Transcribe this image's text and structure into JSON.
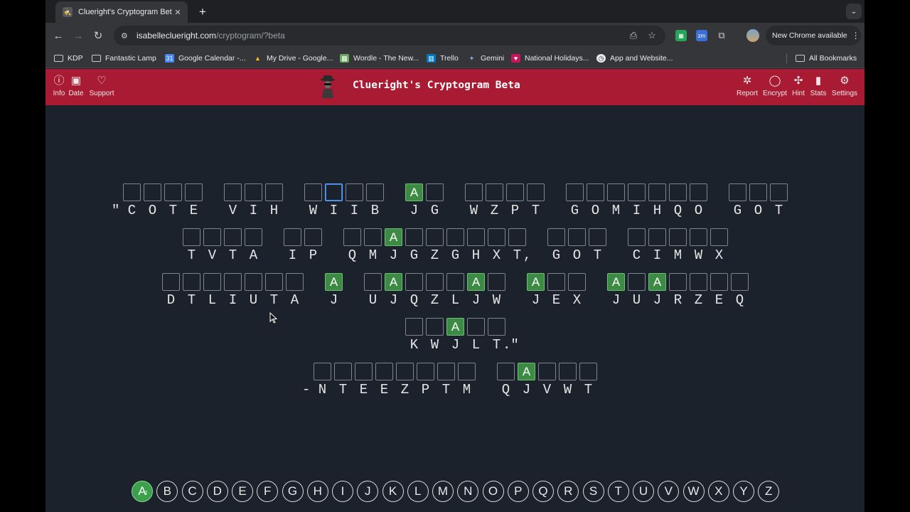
{
  "browser": {
    "tab_title": "Clueright's Cryptogram Beta",
    "url_host": "isabelleclueright.com",
    "url_path": "/cryptogram/?beta",
    "update_label": "New Chrome available",
    "bookmarks": [
      "KDP",
      "Fantastic Lamp",
      "Google Calendar -...",
      "My Drive - Google...",
      "Wordle - The New...",
      "Trello",
      "Gemini",
      "National Holidays...",
      "App and Website..."
    ],
    "all_bookmarks": "All Bookmarks",
    "ext_zm": "zm"
  },
  "header": {
    "title": "Clueright's Cryptogram Beta",
    "left_buttons": [
      "Info",
      "Date",
      "Support"
    ],
    "right_buttons": [
      "Report",
      "Encrypt",
      "Hint",
      "Stats",
      "Settings"
    ]
  },
  "puzzle": {
    "rows": [
      {
        "words": [
          {
            "lead": "\"",
            "letters": [
              "C",
              "O",
              "T",
              "E"
            ]
          },
          {
            "letters": [
              "V",
              "I",
              "H"
            ]
          },
          {
            "letters": [
              "W",
              "I",
              "I",
              "B"
            ]
          },
          {
            "letters": [
              "J",
              "G"
            ]
          },
          {
            "letters": [
              "W",
              "Z",
              "P",
              "T"
            ]
          },
          {
            "letters": [
              "G",
              "O",
              "M",
              "I",
              "H",
              "Q",
              "O"
            ]
          },
          {
            "letters": [
              "G",
              "O",
              "T"
            ]
          }
        ]
      },
      {
        "words": [
          {
            "letters": [
              "T",
              "V",
              "T",
              "A"
            ]
          },
          {
            "letters": [
              "I",
              "P"
            ]
          },
          {
            "letters": [
              "Q",
              "M",
              "J",
              "G",
              "Z",
              "G",
              "H",
              "X",
              "T"
            ],
            "trail": ","
          },
          {
            "letters": [
              "G",
              "O",
              "T"
            ]
          },
          {
            "letters": [
              "C",
              "I",
              "M",
              "W",
              "X"
            ]
          }
        ]
      },
      {
        "words": [
          {
            "letters": [
              "D",
              "T",
              "L",
              "I",
              "U",
              "T",
              "A"
            ]
          },
          {
            "letters": [
              "J"
            ]
          },
          {
            "letters": [
              "U",
              "J",
              "Q",
              "Z",
              "L",
              "J",
              "W"
            ]
          },
          {
            "letters": [
              "J",
              "E",
              "X"
            ]
          },
          {
            "letters": [
              "J",
              "U",
              "J",
              "R",
              "Z",
              "E",
              "Q"
            ]
          }
        ]
      },
      {
        "words": [
          {
            "letters": [
              "K",
              "W",
              "J",
              "L",
              "T"
            ],
            "trail": ".\""
          }
        ]
      },
      {
        "words": [
          {
            "lead": "-",
            "letters": [
              "N",
              "T",
              "E",
              "E",
              "Z",
              "P",
              "T",
              "M"
            ]
          },
          {
            "letters": [
              "Q",
              "J",
              "V",
              "W",
              "T"
            ]
          }
        ]
      }
    ],
    "solved": {
      "J": "A"
    }
  },
  "keyboard": {
    "letters": [
      "A",
      "B",
      "C",
      "D",
      "E",
      "F",
      "G",
      "H",
      "I",
      "J",
      "K",
      "L",
      "M",
      "N",
      "O",
      "P",
      "Q",
      "R",
      "S",
      "T",
      "U",
      "V",
      "W",
      "X",
      "Y",
      "Z"
    ],
    "used": {
      "A": "J"
    }
  },
  "colors": {
    "header_bg": "#a81b32",
    "page_bg": "#1b222b",
    "solved_cell": "#3c8a44",
    "used_key": "#3aa04a",
    "active_cell_border": "#5ea6ff"
  }
}
